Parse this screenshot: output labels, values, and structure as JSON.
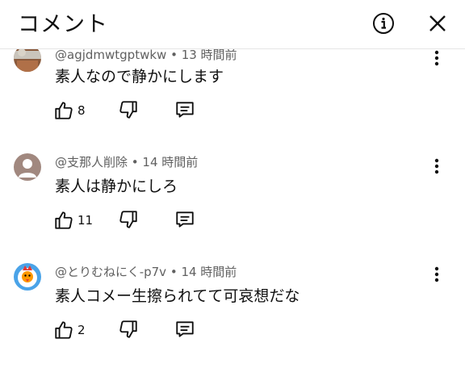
{
  "header": {
    "title": "コメント"
  },
  "comments": [
    {
      "author": "@agjdmwtgptwkw",
      "time": "13 時間前",
      "text": "素人なので静かにします",
      "likes": "8"
    },
    {
      "author": "@支那人削除",
      "time": "14 時間前",
      "text": "素人は静かにしろ",
      "likes": "11"
    },
    {
      "author": "@とりむねにく-p7v",
      "time": "14 時間前",
      "text": "素人コメー生擦られてて可哀想だな",
      "likes": "2"
    }
  ],
  "meta_separator": " • ",
  "icons": {
    "info": "info-icon",
    "close": "close-icon",
    "like": "thumbs-up-icon",
    "dislike": "thumbs-down-icon",
    "reply": "reply-icon",
    "more": "more-vert-icon"
  }
}
